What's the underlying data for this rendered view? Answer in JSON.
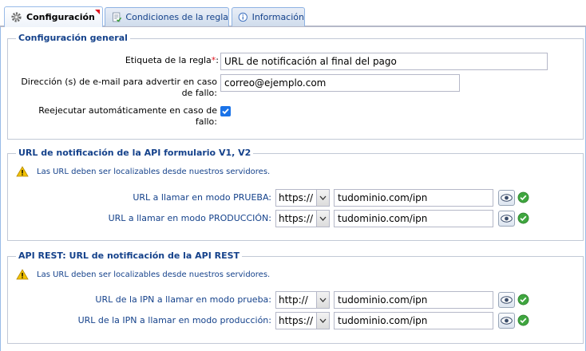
{
  "tabs": [
    {
      "label": "Configuración",
      "icon": "gear-icon",
      "active": true
    },
    {
      "label": "Condiciones de la regla",
      "icon": "document-icon",
      "active": false
    },
    {
      "label": "Información",
      "icon": "info-icon",
      "active": false
    }
  ],
  "general": {
    "legend": "Configuración general",
    "rule_label": "Etiqueta de la regla",
    "required_mark": "*",
    "rule_value": "URL de notificación al final del pago",
    "email_label": "Dirección (s) de e-mail para advertir en caso de fallo:",
    "email_value": "correo@ejemplo.com",
    "retry_label": "Reejecutar automáticamente en caso de fallo:",
    "retry_checked": true
  },
  "api_form": {
    "legend": "URL de notificación de la API formulario V1, V2",
    "warning": "Las URL deben ser localizables desde nuestros servidores.",
    "rows": [
      {
        "label": "URL a llamar en modo PRUEBA:",
        "protocol": "https://",
        "url": "tudominio.com/ipn"
      },
      {
        "label": "URL a llamar en modo PRODUCCIÓN:",
        "protocol": "https://",
        "url": "tudominio.com/ipn"
      }
    ]
  },
  "api_rest": {
    "legend": "API REST: URL de notificación de la API REST",
    "warning": "Las URL deben ser localizables desde nuestros servidores.",
    "rows": [
      {
        "label": "URL de la IPN a llamar en modo prueba:",
        "protocol": "http://",
        "url": "tudominio.com/ipn"
      },
      {
        "label": "URL de la IPN a llamar en modo producción:",
        "protocol": "https://",
        "url": "tudominio.com/ipn"
      }
    ]
  },
  "colors": {
    "accent": "#15428b",
    "required": "#e0141e",
    "ok": "#3fa63f",
    "warning": "#f2c200"
  }
}
